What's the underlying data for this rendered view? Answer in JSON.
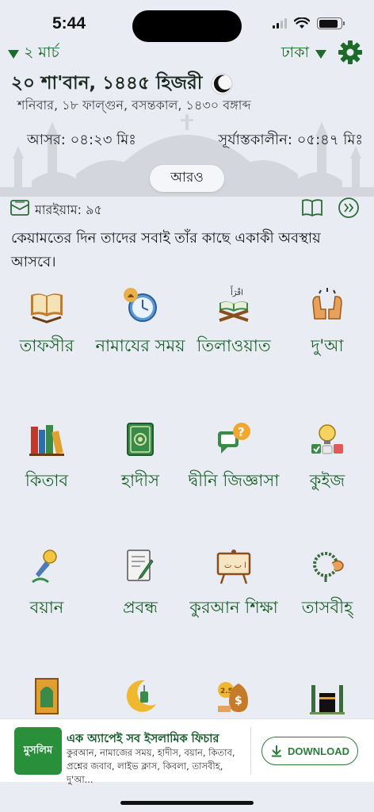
{
  "status": {
    "time": "5:44"
  },
  "header": {
    "date_selector": "২ মার্চ",
    "city_selector": "ঢাকা",
    "hijri_date": "২০ শা'বান, ১৪৪৫ হিজরী",
    "bangla_date": "শনিবার, ১৮ ফাল্গুন, বসন্তকাল, ১৪৩০ বঙ্গাব্দ"
  },
  "prayer": {
    "current": "আসর: ০৪:২৩ মিঃ",
    "sunset": "সূর্যাস্তকালীন: ০৫:৪৭ মিঃ",
    "more_label": "আরও"
  },
  "verse": {
    "reference": "মারইয়াম: ৯৫",
    "text": "কেয়ামতের দিন তাদের সবাই তাঁর কাছে একাকী অবস্থায় আসবে।"
  },
  "features": [
    {
      "label": "তাফসীর",
      "icon": "tafsir-book-icon"
    },
    {
      "label": "নামাযের সময়",
      "icon": "prayer-time-clock-icon"
    },
    {
      "label": "তিলাওয়াত",
      "icon": "quran-recitation-icon"
    },
    {
      "label": "দু'আ",
      "icon": "dua-hands-icon"
    },
    {
      "label": "কিতাব",
      "icon": "books-icon"
    },
    {
      "label": "হাদীস",
      "icon": "hadith-book-icon"
    },
    {
      "label": "দ্বীনি জিজ্ঞাসা",
      "icon": "question-bubble-icon"
    },
    {
      "label": "কুইজ",
      "icon": "quiz-bulb-icon"
    },
    {
      "label": "বয়ান",
      "icon": "microphone-icon"
    },
    {
      "label": "প্রবন্ধ",
      "icon": "article-pen-icon"
    },
    {
      "label": "কুরআন শিক্ষা",
      "icon": "quran-board-icon"
    },
    {
      "label": "তাসবীহ্",
      "icon": "tasbih-beads-icon"
    },
    {
      "label": "",
      "icon": "prayer-mat-icon"
    },
    {
      "label": "",
      "icon": "crescent-lantern-icon"
    },
    {
      "label": "",
      "icon": "zakat-money-icon"
    },
    {
      "label": "",
      "icon": "kaaba-icon"
    }
  ],
  "ad": {
    "logo_text": "মুসলিম",
    "title": "এক অ্যাপেই সব ইসলামিক ফিচার",
    "description": "কুরআন, নামাজের সময়, হাদীস, বয়ান, কিতাব, প্রশ্নের জবাব, লাইভ ক্লাস, কিবলা, তাসবীহ, দু'আ...",
    "button_label": "DOWNLOAD"
  },
  "colors": {
    "accent": "#1d6b2b",
    "label_green": "#1a5f2a",
    "background": "#e9edf3"
  }
}
